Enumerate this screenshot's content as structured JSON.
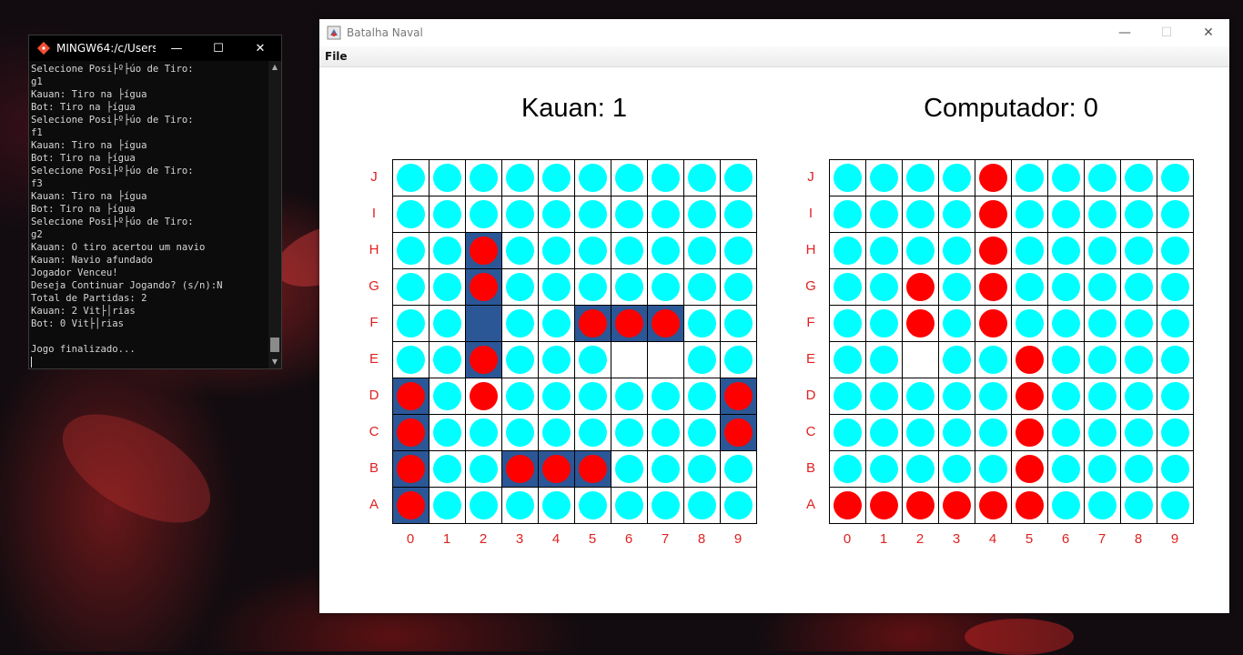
{
  "terminal": {
    "title": "MINGW64:/c/Users...",
    "lines": [
      "Selecione Posi├º├úo de Tiro:",
      "g1",
      "Kauan: Tiro na ├ígua",
      "Bot: Tiro na ├ígua",
      "Selecione Posi├º├úo de Tiro:",
      "f1",
      "Kauan: Tiro na ├ígua",
      "Bot: Tiro na ├ígua",
      "Selecione Posi├º├úo de Tiro:",
      "f3",
      "Kauan: Tiro na ├ígua",
      "Bot: Tiro na ├ígua",
      "Selecione Posi├º├úo de Tiro:",
      "g2",
      "Kauan: O tiro acertou um navio",
      "Kauan: Navio afundado",
      "Jogador Venceu!",
      "Deseja Continuar Jogando? (s/n):N",
      "Total de Partidas: 2",
      "Kauan: 2 Vit├│rias",
      "Bot: 0 Vit├│rias",
      "",
      "Jogo finalizado..."
    ]
  },
  "window": {
    "title": "Batalha Naval",
    "menu": [
      "File"
    ]
  },
  "boards": [
    {
      "score": "Kauan: 1",
      "rows": [
        "wwwwwwwwww",
        "wwwwwwwwww",
        "wwhwwwwwww",
        "wwhwwwwwww",
        "wwSwwhhhww",
        "wwhwwweeww",
        "hwhwwwwwwh",
        "hwwwwwwwwh",
        "hwwhhhwwww",
        "hwwwwwwwww"
      ],
      "ships": [
        {
          "col": 2,
          "row": 2,
          "len": 4,
          "dir": "v"
        },
        {
          "col": 5,
          "row": 4,
          "len": 3,
          "dir": "h"
        },
        {
          "col": 0,
          "row": 6,
          "len": 4,
          "dir": "v"
        },
        {
          "col": 9,
          "row": 6,
          "len": 2,
          "dir": "v"
        },
        {
          "col": 3,
          "row": 8,
          "len": 3,
          "dir": "h"
        }
      ]
    },
    {
      "score": "Computador: 0",
      "rows": [
        "wwwwhwwwww",
        "wwwwhwwwww",
        "wwwwhwwwww",
        "wwhwhwwwww",
        "wwhwhwwwww",
        "wwewwhwwww",
        "wwwwwhwwww",
        "wwwwwhwwww",
        "wwwwwhwwww",
        "hhhhhhwwww"
      ],
      "ships": []
    }
  ],
  "row_labels": [
    "J",
    "I",
    "H",
    "G",
    "F",
    "E",
    "D",
    "C",
    "B",
    "A"
  ],
  "col_labels": [
    "0",
    "1",
    "2",
    "3",
    "4",
    "5",
    "6",
    "7",
    "8",
    "9"
  ],
  "colors": {
    "water": "#00ffff",
    "hit": "#ff0000",
    "ship": "#2b5797",
    "label": "#e02020"
  }
}
